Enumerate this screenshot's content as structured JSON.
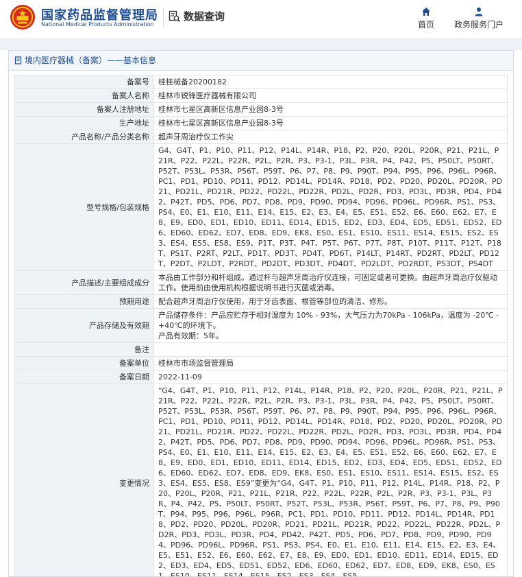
{
  "header": {
    "site_name_cn": "国家药品监督管理局",
    "site_name_en": "National Medical Products Administration",
    "query_label": "数据查询",
    "nav": [
      {
        "label": "首页",
        "icon": "home-icon"
      },
      {
        "label": "政务服务门户",
        "icon": "user-icon"
      }
    ]
  },
  "breadcrumb": "境内医疗器械（备案）——基本信息",
  "rows": [
    {
      "label": "备案号",
      "value": "桂桂械备20200182"
    },
    {
      "label": "备案人名称",
      "value": "桂林市锐锋医疗器械有限公司"
    },
    {
      "label": "备案人注册地址",
      "value": "桂林市七星区高新区信息产业园8-3号"
    },
    {
      "label": "生产地址",
      "value": "桂林市七星区高新区信息产业园8-3号"
    },
    {
      "label": "产品名称/产品分类名称",
      "value": "超声牙周治疗仪工作尖"
    },
    {
      "label": "型号规格/包装规格",
      "value": "G4、G4T、P1、P10、P11、P12、P14L、P14R、P18、P2、P20、P20L、P20R、P21、P21L、P21R、P22、P22L、P22R、P2L、P2R、P3、P3-1、P3L、P3R、P4、P42、P5、P50LT、P50RT、P52T、P53L、P53R、P56T、P59T、P6、P7、P8、P9、P90T、P94、P95、P96、P96L、P96R、PC1、PD1、PD10、PD11、PD12、PD14L、PD14R、PD18、PD2、PD20、PD20L、PD20R、PD21、PD21L、PD21R、PD22、PD22L、PD22R、PD2L、PD2R、PD3、PD3L、PD3R、PD4、PD42、P42T、PD5、PD6、PD7、PD8、PD9、PD90、PD94、PD96、PD96L、PD96R、PS1、PS3、PS4、E0、E1、E10、E11、E14、E15、E2、E3、E4、E5、E51、E52、E6、E60、E62、E7、E8、E9、ED0、ED1、ED10、ED11、ED14、ED15、ED2、ED3、ED4、ED5、ED51、ED52、ED6、ED60、ED62、ED7、ED8、ED9、EK8、ES0、ES1、ES10、ES11、ES14、ES15、ES2、ES3、ES4、ES5、ES8、ES9、P1T、P3T、P4T、P5T、P6T、P7T、P8T、P10T、P11T、P12T、P18T、PS1T、P2RT、P2LT、PD1T、PD3T、PD4T、PD6T、P14LT、P14RT、PD2RT、PD2LT、PD12T、P2DT、P2LDT、P2RDT、PD2DT、PD3DT、PD4DT、PD2LDT、PD2RDT、PS3DT、PS4DT"
    },
    {
      "label": "产品描述/主要组成成分",
      "value": "本品由工作部分和杆组成。通过杆与超声牙周治疗仪连接，可固定或者可更换。由超声牙周治疗仪驱动工作。使用前由使用机构根据说明书进行灭菌或消毒。"
    },
    {
      "label": "预期用途",
      "value": "配合超声牙周治疗仪使用，用于牙齿表面、根管等部位的清洁、修形。"
    },
    {
      "label": "产品存储及有效期",
      "value": "产品储存条件：产品应贮存于相对湿度为 10% - 93%，大气压力为70kPa - 106kPa，温度为 -20℃ - +40℃的环境下。\n产品有效期：5年。"
    },
    {
      "label": "备注",
      "value": ""
    },
    {
      "label": "备案单位",
      "value": "桂林市市场监督管理局"
    },
    {
      "label": "备案日期",
      "value": "2022-11-09"
    },
    {
      "label": "变更情况",
      "value": "“G4、G4T、P1、P10、P11、P12、P14L、P14R、P18、P2、P20、P20L、P20R、P21、P21L、P21R、P22、P22L、P22R、P2L、P2R、P3、P3-1、P3L、P3R、P4、P42、P5、P50LT、P50RT、P52T、P53L、P53R、P56T、P59T、P6、P7、P8、P9、P90T、P94、P95、P96、P96L、P96R、PC1、PD1、PD10、PD11、PD12、PD14L、PD14R、PD18、PD2、PD20、PD20L、PD20R、PD21、PD21L、PD21R、PD22、PD22L、PD22R、PD2L、PD2R、PD3、PD3L、PD3R、PD4、PD42、P42T、PD5、PD6、PD7、PD8、PD9、PD90、PD94、PD96、PD96L、PD96R、PS1、PS3、PS4、E0、E1、E10、E11、E14、E15、E2、E3、E4、E5、E51、E52、E6、E60、E62、E7、E8、E9、ED0、ED1、ED10、ED11、ED14、ED15、ED2、ED3、ED4、ED5、ED51、ED52、ED6、ED60、ED62、ED7、ED8、ED9、EK8、ES0、ES1、ES10、ES11、ES14、ES15、ES2、ES3、ES4、ES5、ES8、ES9”变更为“G4、G4T、P1、P10、P11、P12、P14L、P14R、P18、P2、P20、P20L、P20R、P21、P21L、P21R、P22、P22L、P22R、P2L、P2R、P3、P3-1、P3L、P3R、P4、P42、P5、P50LT、P50RT、P52T、P53L、P53R、P56T、P59T、P6、P7、P8、P9、P90T、P94、P95、P96、P96L、P96R、PC1、PD1、PD10、PD11、PD12、PD14L、PD14R、PD18、PD2、PD20、PD20L、PD20R、PD21、PD21L、PD21R、PD22、PD22L、PD22R、PD2L、PD2R、PD3、PD3L、PD3R、PD4、PD42、P42T、PD5、PD6、PD7、PD8、PD9、PD90、PD94、PD96、PD96L、PD96R、PS1、PS3、PS4、E0、E1、E10、E11、E14、E15、E2、E3、E4、E5、E51、E52、E6、E60、E62、E7、E8、E9、ED0、ED1、ED10、ED11、ED14、ED15、ED2、ED3、ED4、ED5、ED51、ED52、ED6、ED60、ED62、ED7、ED8、ED9、EK8、ES0、ES1、ES10、ES11、ES14、ES15、ES2、ES3、ES4、ES5、"
    }
  ]
}
